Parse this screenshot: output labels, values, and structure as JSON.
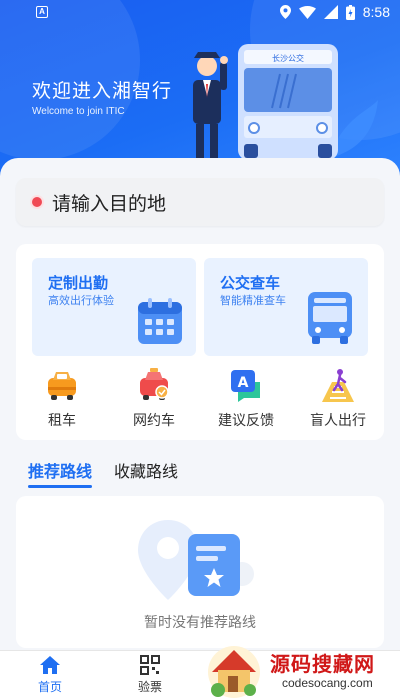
{
  "status_bar": {
    "time": "8:58",
    "app_badge": "A"
  },
  "hero": {
    "title": "欢迎进入湘智行",
    "subtitle": "Welcome to join ITIC",
    "bus_sign": "长沙公交"
  },
  "search": {
    "placeholder": "请输入目的地"
  },
  "services": {
    "custom_commute": {
      "title": "定制出勤",
      "subtitle": "高效出行体验",
      "icon": "calendar-icon"
    },
    "bus_lookup": {
      "title": "公交查车",
      "subtitle": "智能精准查车",
      "icon": "bus-icon"
    }
  },
  "quick_actions": [
    {
      "label": "租车",
      "icon": "car-rental-icon"
    },
    {
      "label": "网约车",
      "icon": "ride-hailing-icon"
    },
    {
      "label": "建议反馈",
      "icon": "feedback-icon"
    },
    {
      "label": "盲人出行",
      "icon": "blind-travel-icon"
    }
  ],
  "route_tabs": {
    "recommended": "推荐路线",
    "favorites": "收藏路线",
    "active": "推荐路线"
  },
  "routes": {
    "empty_message": "暂时没有推荐路线"
  },
  "bottom_nav": {
    "home": "首页",
    "ticket": "验票"
  },
  "watermark": {
    "title": "源码搜藏网",
    "subtitle": "codesocang.com"
  },
  "colors": {
    "accent": "#1f6ff2",
    "hero_bg": "#1b6df5",
    "search_dot": "#f04a55",
    "watermark_red": "#d01818"
  }
}
